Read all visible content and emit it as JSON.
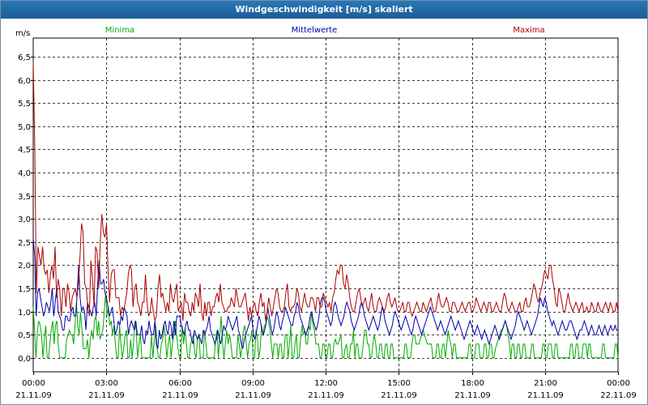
{
  "window": {
    "title": "Windgeschwindigkeit [m/s] skaliert"
  },
  "chart_data": {
    "type": "line",
    "ylabel": "m/s",
    "ylim": [
      -0.3,
      6.9
    ],
    "yticks": [
      "0,0",
      "0,5",
      "1,0",
      "1,5",
      "2,0",
      "2,5",
      "3,0",
      "3,5",
      "4,0",
      "4,5",
      "5,0",
      "5,5",
      "6,0",
      "6,5"
    ],
    "xticks": [
      {
        "time": "00:00",
        "date": "21.11.09"
      },
      {
        "time": "03:00",
        "date": "21.11.09"
      },
      {
        "time": "06:00",
        "date": "21.11.09"
      },
      {
        "time": "09:00",
        "date": "21.11.09"
      },
      {
        "time": "12:00",
        "date": "21.11.09"
      },
      {
        "time": "15:00",
        "date": "21.11.09"
      },
      {
        "time": "18:00",
        "date": "21.11.09"
      },
      {
        "time": "21:00",
        "date": "21.11.09"
      },
      {
        "time": "00:00",
        "date": "22.11.09"
      }
    ],
    "grid": true,
    "x_interval_minutes": 10,
    "series": [
      {
        "name": "Minima",
        "color": "#00aa00",
        "values": [
          1.1,
          0.6,
          0,
          0.6,
          0.8,
          0.7,
          0.5,
          0,
          0.4,
          0.7,
          0,
          0,
          0.3,
          0.6,
          0.8,
          0.3,
          0.7,
          0.8,
          0.3,
          0,
          0,
          0,
          0,
          0,
          0.4,
          0.5,
          0.6,
          0.5,
          0.5,
          0.3,
          0.7,
          1.2,
          0.7,
          0.5,
          1,
          0.6,
          0.2,
          0.2,
          0.2,
          0.4,
          0,
          0.4,
          0.6,
          0.4,
          0.8,
          0.9,
          0.5,
          0.8,
          0.4,
          0.5,
          0.6,
          1,
          1.4,
          0.9,
          1.1,
          0.7,
          0.8,
          0.5,
          0.7,
          0.3,
          0,
          0,
          0.7,
          0.3,
          0,
          0.2,
          0.5,
          0.6,
          0,
          0,
          0.4,
          0,
          0.3,
          0.8,
          0.6,
          0,
          0.3,
          0.5,
          0,
          0,
          0,
          0,
          0,
          0,
          0,
          0.5,
          0,
          0.4,
          0.7,
          0.2,
          0,
          0,
          0.3,
          0.4,
          0.7,
          0.4,
          0,
          0.3,
          0.5,
          0,
          0.3,
          0.5,
          0.8,
          0.5,
          0.2,
          0,
          0,
          0.7,
          0.3,
          0.6,
          0.3,
          0,
          0,
          0.3,
          0.4,
          0.5,
          0.1,
          0,
          0.4,
          0.5,
          0,
          0,
          0,
          0.6,
          0.3,
          0,
          0,
          0,
          0,
          0,
          0,
          0.4,
          0.6,
          0,
          0.5,
          0.9,
          0.3,
          0,
          0.3,
          0.6,
          0.3,
          0.5,
          0.3,
          0,
          0,
          0,
          0,
          0.5,
          0.3,
          0,
          0.3,
          0.6,
          0.7,
          0.3,
          0,
          0.3,
          0.4,
          0.6,
          0,
          0,
          0.6,
          0.4,
          0,
          0.2,
          0.7,
          0.5,
          0.7,
          0.7,
          0.9,
          0.8,
          0.6,
          0.3,
          0,
          0.3,
          0.3,
          0.3,
          0,
          0.3,
          0.3,
          0,
          0,
          0.5,
          0.5,
          0,
          0.3,
          0.7,
          0,
          0,
          0.3,
          0.5,
          0,
          0,
          0.4,
          0.7,
          0.5,
          0.6,
          0.3,
          0.3,
          0.7,
          0.6,
          1,
          0.7,
          0.6,
          0.3,
          0.3,
          0.3,
          0,
          0,
          0.3,
          0.3,
          0,
          0,
          0.3,
          0.3,
          0,
          0,
          0.3,
          0.4,
          0.3,
          0.3,
          0.4,
          0.5,
          0,
          0,
          0.2,
          0.3,
          0,
          0,
          0.3,
          0.3,
          0.6,
          0,
          0.3,
          0.3,
          0,
          0,
          0,
          0.3,
          0.6,
          0.6,
          0.3,
          0.3,
          0,
          0,
          0.3,
          0.5,
          0.3,
          0,
          0,
          0.3,
          0.3,
          0,
          0,
          0.3,
          0.3,
          0,
          0,
          0.3,
          0.3,
          0,
          0,
          0,
          0,
          0,
          0,
          0,
          0,
          0.3,
          0.3,
          0,
          0,
          0,
          0.3,
          0.5,
          0.5,
          0.3,
          0.3,
          0.3,
          0.4,
          0.5,
          0.6,
          0.5,
          0.4,
          0.3,
          0.3,
          0.3,
          0.3,
          0,
          0,
          0,
          0.3,
          0.3,
          0,
          0,
          0.3,
          0.3,
          0,
          0.3,
          0.6,
          0.4,
          0.3,
          0,
          0.3,
          0.3,
          0,
          0,
          0,
          0,
          0,
          0,
          0,
          0,
          0,
          0.3,
          0.3,
          0,
          0,
          0,
          0.3,
          0.3,
          0.3,
          0,
          0,
          0,
          0.3,
          0.3,
          0,
          0,
          0.3,
          0.3,
          0,
          0,
          0.2,
          0.3,
          0.4,
          0.5,
          0.6,
          0.6,
          0.7,
          0.8,
          0.7,
          0.5,
          0.3,
          0,
          0.3,
          0.3,
          0,
          0,
          0.3,
          0.3,
          0,
          0,
          0.3,
          0.3,
          0,
          0,
          0,
          0,
          0.3,
          0.3,
          0,
          0,
          0,
          0,
          0,
          0,
          0.3,
          0.3,
          0,
          0,
          0.3,
          0.3,
          0.3,
          0,
          0,
          0.3,
          0.3,
          0,
          0,
          0,
          0,
          0,
          0,
          0,
          0,
          0,
          0.3,
          0.3,
          0,
          0,
          0.3,
          0.3,
          0,
          0,
          0,
          0.3,
          0.3,
          0.3,
          0,
          0.3,
          0.3,
          0,
          0,
          0,
          0,
          0,
          0,
          0,
          0,
          0.3,
          0.3,
          0,
          0,
          0,
          0,
          0,
          0,
          0,
          0.3,
          0.3,
          0
        ]
      },
      {
        "name": "Mittelwerte",
        "color": "#0000aa",
        "values": [
          2.6,
          2.2,
          0.9,
          1.4,
          1.5,
          1.3,
          1.1,
          0.9,
          1,
          1.2,
          1.1,
          1,
          1.2,
          1.5,
          0.9,
          1.2,
          1.5,
          1,
          0.9,
          0.8,
          0.6,
          0.6,
          0.9,
          0.9,
          0.8,
          0.8,
          1,
          1.1,
          0.9,
          0.9,
          1.4,
          2,
          1.3,
          1,
          1.1,
          1,
          0.6,
          1.2,
          1.1,
          1,
          0.9,
          1.1,
          1.2,
          0.9,
          1.6,
          2.1,
          1.6,
          1.6,
          1.7,
          1.4,
          1.3,
          1.1,
          0.9,
          1,
          1.1,
          0.8,
          0.5,
          0.6,
          0.8,
          0.7,
          0.9,
          0.8,
          1.1,
          1,
          0.9,
          0.5,
          0.7,
          0.8,
          0.7,
          0.6,
          0.8,
          0.5,
          0.5,
          0.5,
          0.7,
          0.4,
          0.3,
          0.6,
          0.5,
          0.8,
          0.6,
          0.5,
          0.5,
          0.8,
          0.3,
          0.2,
          0.6,
          0.4,
          0.5,
          0.7,
          0.8,
          0.6,
          0.5,
          0.8,
          0.7,
          0.4,
          0.8,
          0.5,
          0.9,
          0.9,
          0.9,
          0.7,
          0.6,
          0.5,
          0.7,
          0.8,
          0.6,
          0.6,
          0.4,
          0.3,
          0.6,
          0.5,
          0.4,
          0.5,
          0.4,
          0.3,
          0.6,
          0.5,
          0.6,
          0.7,
          0.9,
          0.6,
          0.5,
          0.4,
          0.3,
          0.4,
          0.6,
          0.4,
          0.3,
          0.5,
          0.7,
          0.6,
          0.7,
          0.9,
          0.8,
          0.7,
          0.6,
          0.7,
          0.8,
          0.9,
          0.6,
          0.5,
          0.3,
          0.2,
          0.4,
          0.5,
          0.6,
          0.7,
          0.8,
          0.9,
          0.6,
          0.4,
          0.5,
          0.7,
          0.9,
          0.8,
          0.6,
          0.5,
          0.6,
          0.8,
          1.1,
          0.9,
          0.7,
          0.5,
          0.6,
          0.8,
          1,
          0.9,
          0.7,
          0.6,
          0.8,
          0.9,
          1.1,
          1,
          0.9,
          0.8,
          0.7,
          0.7,
          0.9,
          1,
          1.2,
          1.1,
          0.9,
          0.8,
          0.7,
          0.6,
          0.5,
          0.6,
          0.7,
          0.9,
          1,
          0.8,
          0.7,
          0.6,
          0.7,
          0.9,
          1.2,
          1.3,
          1.3,
          1.2,
          1,
          0.9,
          0.8,
          0.7,
          0.8,
          1.1,
          1.2,
          1.1,
          0.9,
          0.8,
          0.7,
          0.8,
          0.9,
          1.1,
          1.2,
          1.1,
          1,
          0.8,
          0.7,
          0.6,
          0.7,
          0.8,
          0.9,
          1.1,
          1.2,
          1.1,
          0.9,
          0.8,
          0.7,
          0.6,
          0.7,
          0.8,
          0.9,
          0.8,
          0.7,
          0.6,
          0.7,
          0.9,
          1.1,
          1,
          0.8,
          0.7,
          0.6,
          0.5,
          0.6,
          0.7,
          0.9,
          1,
          0.9,
          0.8,
          0.7,
          0.6,
          0.7,
          0.8,
          0.9,
          0.8,
          0.7,
          0.6,
          0.5,
          0.6,
          0.8,
          0.9,
          0.8,
          0.7,
          0.6,
          0.5,
          0.6,
          0.7,
          0.8,
          0.9,
          1,
          1.1,
          1,
          0.9,
          0.8,
          0.7,
          0.6,
          0.7,
          0.8,
          0.7,
          0.6,
          0.5,
          0.6,
          0.7,
          0.8,
          0.9,
          0.8,
          0.7,
          0.6,
          0.7,
          0.8,
          0.7,
          0.6,
          0.5,
          0.4,
          0.5,
          0.6,
          0.7,
          0.8,
          0.7,
          0.6,
          0.5,
          0.6,
          0.7,
          0.6,
          0.5,
          0.4,
          0.5,
          0.6,
          0.5,
          0.4,
          0.3,
          0.4,
          0.5,
          0.6,
          0.7,
          0.6,
          0.5,
          0.4,
          0.5,
          0.6,
          0.7,
          0.8,
          0.7,
          0.6,
          0.5,
          0.4,
          0.5,
          0.6,
          0.7,
          0.9,
          1,
          0.9,
          0.8,
          0.7,
          0.6,
          0.7,
          0.8,
          0.7,
          0.6,
          0.5,
          0.6,
          0.7,
          0.8,
          0.9,
          1.1,
          1.3,
          1.2,
          1.1,
          1.3,
          1.2,
          1,
          0.9,
          0.8,
          0.7,
          0.8,
          0.7,
          0.6,
          0.5,
          0.6,
          0.7,
          0.8,
          0.7,
          0.6,
          0.6,
          0.7,
          0.8,
          0.8,
          0.7,
          0.6,
          0.5,
          0.4,
          0.5,
          0.6,
          0.6,
          0.7,
          0.8,
          0.7,
          0.6,
          0.5,
          0.6,
          0.7,
          0.6,
          0.5,
          0.5,
          0.6,
          0.7,
          0.6,
          0.5,
          0.6,
          0.7,
          0.6,
          0.5,
          0.6,
          0.7,
          0.6,
          0.6,
          0.7,
          0.6,
          0.6
        ]
      },
      {
        "name": "Maxima",
        "color": "#aa0000",
        "values": [
          6.4,
          4.6,
          1.4,
          2.4,
          2.2,
          2,
          2.4,
          1.9,
          1.8,
          1.9,
          1.4,
          1.8,
          2,
          1.7,
          2.4,
          1.3,
          1.7,
          1.5,
          0.9,
          1.5,
          1.5,
          1.1,
          1.6,
          1.4,
          1,
          1.3,
          1.4,
          1.5,
          1.3,
          1.6,
          2.2,
          2.9,
          2.7,
          1.6,
          1.5,
          1.1,
          0.9,
          2.1,
          1.7,
          1.1,
          2.4,
          2.3,
          1.5,
          2.5,
          3.1,
          2.7,
          2.6,
          2.9,
          1.9,
          1.2,
          1.8,
          1.9,
          1.9,
          1.3,
          1.3,
          1.3,
          0.9,
          1.1,
          1,
          1.2,
          1.4,
          1.8,
          2,
          1.9,
          1.1,
          1.5,
          1.6,
          1.2,
          1.1,
          0.9,
          1.2,
          1.2,
          1.8,
          1.2,
          0.9,
          1,
          1.3,
          1,
          0.8,
          0.9,
          1.5,
          1.8,
          1.3,
          1.4,
          1.2,
          1,
          1.2,
          1,
          1.6,
          1.3,
          1.2,
          1.4,
          1.6,
          1,
          1.1,
          1.2,
          0.8,
          1.4,
          1.2,
          1.2,
          1,
          0.9,
          1.2,
          1,
          1.4,
          1.3,
          1.1,
          1.6,
          1,
          0.8,
          1.2,
          0.9,
          1.2,
          1.2,
          0.9,
          1.1,
          1.1,
          1.3,
          1.4,
          1.2,
          1.6,
          1.2,
          1.1,
          1,
          1,
          1.1,
          1.1,
          1.3,
          1.2,
          1.1,
          1.5,
          1.3,
          1.1,
          1.1,
          1.2,
          1.3,
          1.4,
          1.1,
          0.8,
          1.1,
          0.9,
          1.1,
          1.2,
          1,
          0.9,
          1.2,
          1.4,
          1.1,
          1.2,
          0.8,
          1,
          1.3,
          1.1,
          0.9,
          1.1,
          1.3,
          1.5,
          1.4,
          1.1,
          1,
          1,
          1.1,
          1.4,
          1.6,
          1.1,
          1,
          1.1,
          1.1,
          1.2,
          1.5,
          1.4,
          1.1,
          1,
          1.2,
          1.4,
          1.2,
          1.1,
          1.1,
          1.3,
          1.3,
          1.2,
          1,
          1.3,
          1.3,
          1.1,
          1.1,
          1.4,
          1.3,
          1.2,
          1.1,
          1.2,
          1,
          1.3,
          1.4,
          1.7,
          1.9,
          1.8,
          2,
          2,
          1.6,
          1.5,
          1.8,
          1.6,
          1.3,
          1.1,
          1,
          1,
          1.2,
          1.4,
          1.5,
          1.3,
          1.1,
          1.2,
          1.3,
          1.1,
          1,
          1.2,
          1.4,
          1.1,
          1,
          1,
          1.2,
          1.3,
          1.2,
          1.1,
          1,
          1.1,
          1.3,
          1.4,
          1.2,
          1.1,
          1.2,
          1.3,
          1.1,
          1,
          1,
          1.1,
          1.2,
          1,
          1,
          1.2,
          1.2,
          1,
          0.9,
          1,
          1.1,
          1.2,
          1.1,
          1,
          1,
          1.2,
          1.1,
          1,
          1.1,
          1.2,
          1.3,
          1.1,
          1,
          1,
          1.2,
          1.4,
          1.2,
          1.1,
          1.1,
          1.2,
          1.3,
          1.2,
          1,
          1,
          1.2,
          1.2,
          1.1,
          1,
          1,
          1.1,
          1.2,
          1.1,
          1,
          1.1,
          1.2,
          1.2,
          1,
          1,
          1.1,
          1.3,
          1.2,
          1.1,
          1,
          1.1,
          1.2,
          1.1,
          1,
          1.2,
          1.2,
          1,
          1,
          1.1,
          1.2,
          1.1,
          1,
          1,
          1.2,
          1.4,
          1.3,
          1.1,
          1,
          1.1,
          1.2,
          1.1,
          1,
          1,
          1.1,
          1.2,
          1,
          1,
          1.2,
          1.3,
          1.1,
          1.1,
          1.2,
          1.4,
          1.6,
          1.5,
          1.3,
          1.2,
          1.4,
          1.5,
          1.7,
          1.9,
          1.8,
          1.7,
          2,
          2,
          1.7,
          1.5,
          1.2,
          1.1,
          1.5,
          1.4,
          1.2,
          1,
          1,
          1.2,
          1.4,
          1.2,
          1.1,
          1,
          1.1,
          1.2,
          1.1,
          1,
          1.1,
          1.2,
          1,
          1,
          1.1,
          1,
          1,
          1.2,
          1.1,
          1,
          1,
          1.2,
          1.1,
          1,
          1,
          1.1,
          1.2,
          1.1,
          1,
          1.2,
          1.1,
          1,
          1,
          1.2,
          1
        ]
      }
    ]
  }
}
